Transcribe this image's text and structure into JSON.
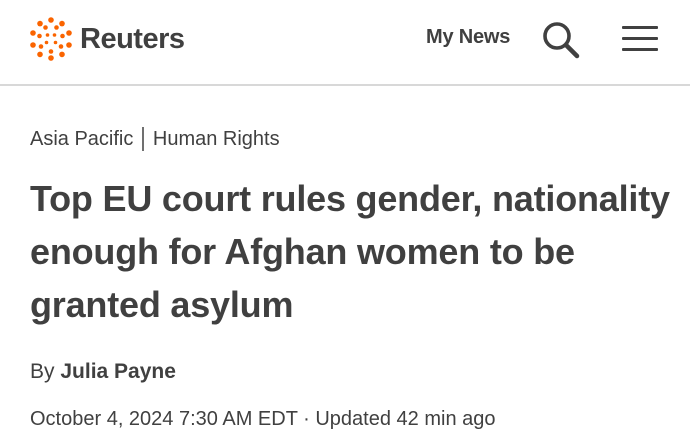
{
  "header": {
    "logo_text": "Reuters",
    "logo_icon": "reuters-dots-icon",
    "my_news_label": "My News",
    "search_icon": "search-icon",
    "menu_icon": "hamburger-menu-icon",
    "brand_color": "#fa6400"
  },
  "article": {
    "breadcrumb": [
      "Asia Pacific",
      "Human Rights"
    ],
    "headline": "Top EU court rules gender, nationality enough for Afghan women to be granted asylum",
    "byline_prefix": "By",
    "author": "Julia Payne",
    "date": "October 4, 2024 7:30 AM EDT",
    "separator": "·",
    "updated": "Updated 42 min ago"
  }
}
